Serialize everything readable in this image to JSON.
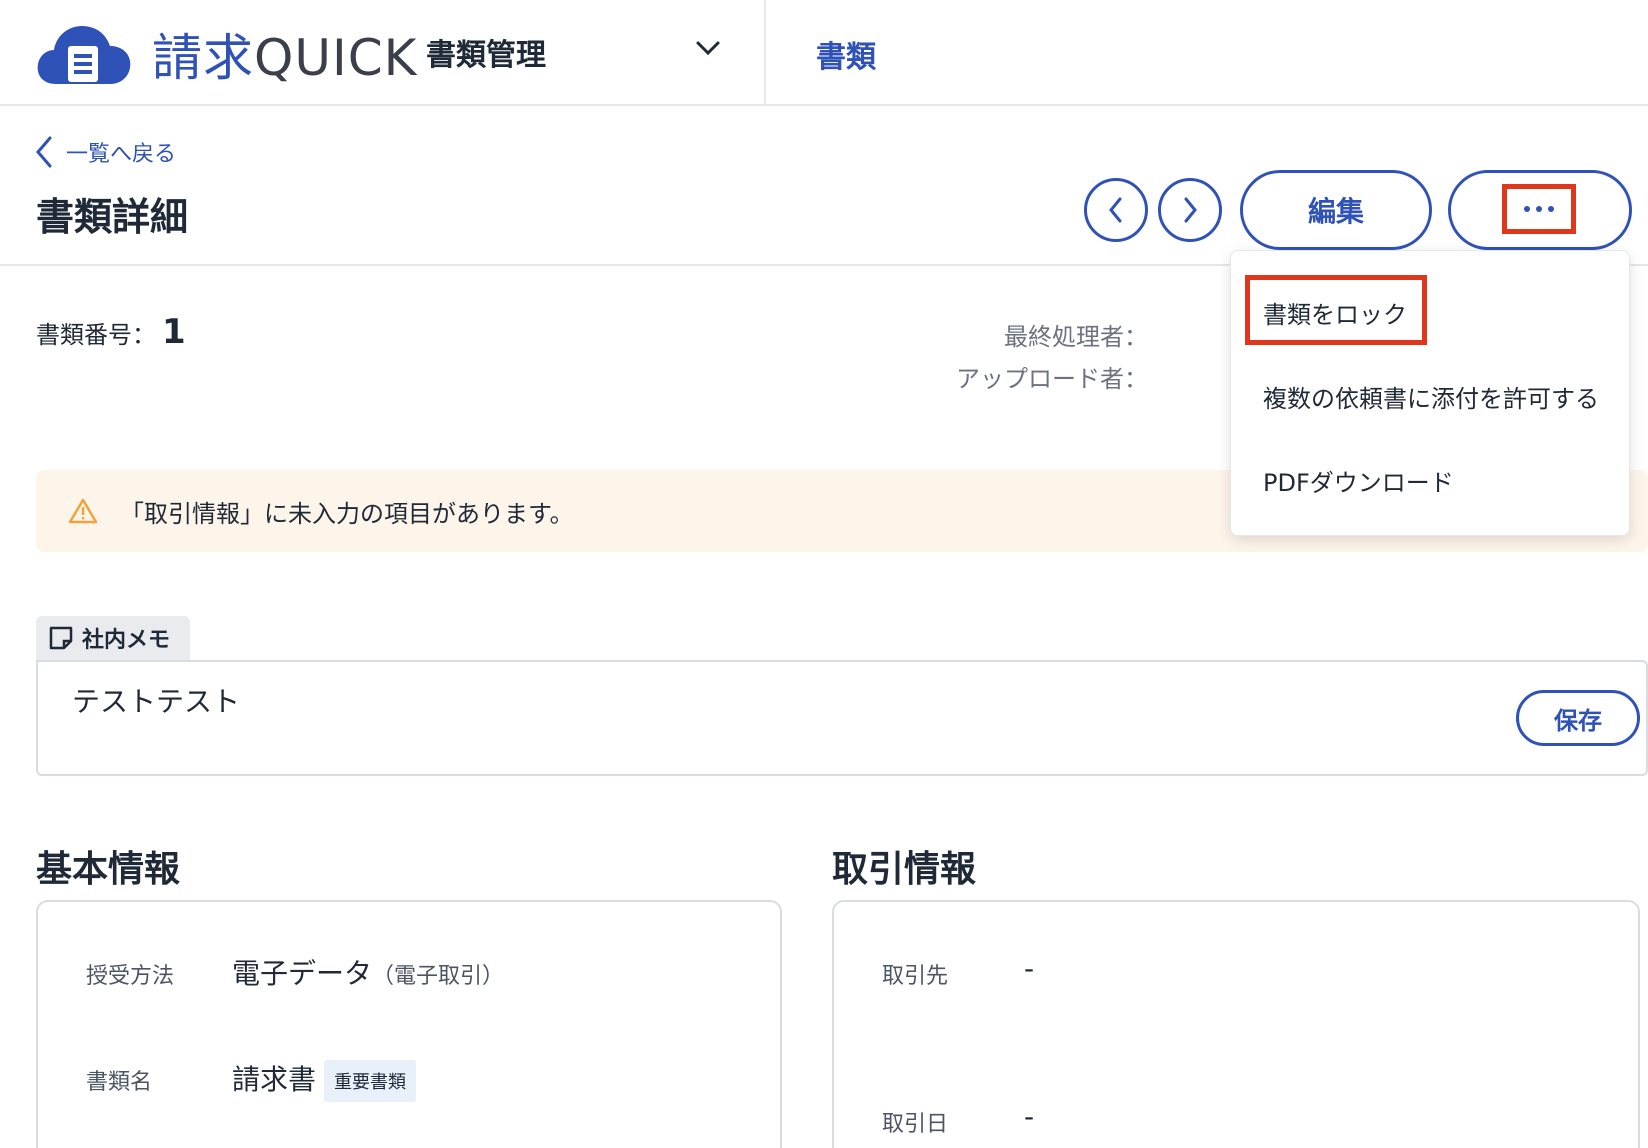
{
  "header": {
    "logo_text_jp": "請求",
    "logo_text_en": "QUICK",
    "app_select": "書類管理",
    "nav_tab": "書類"
  },
  "subheader": {
    "back_label": "一覧へ戻る",
    "page_title": "書類詳細",
    "edit_label": "編集"
  },
  "meta": {
    "doc_no_label": "書類番号：",
    "doc_no": "1",
    "last_processor_label": "最終処理者：",
    "uploader_label": "アップロード者："
  },
  "warning": {
    "text": "「取引情報」に未入力の項目があります。"
  },
  "memo": {
    "tab_label": "社内メモ",
    "text": "テストテスト",
    "save_label": "保存"
  },
  "basic_info": {
    "title": "基本情報",
    "fields": [
      {
        "label": "授受方法",
        "value": "電子データ",
        "sub": "（電子取引）"
      },
      {
        "label": "書類名",
        "value": "請求書",
        "badge": "重要書類"
      }
    ]
  },
  "transaction_info": {
    "title": "取引情報",
    "fields": [
      {
        "label": "取引先",
        "value": "-"
      },
      {
        "label": "取引日",
        "value": "-"
      }
    ]
  },
  "dropdown": {
    "items": [
      {
        "label": "書類をロック"
      },
      {
        "label": "複数の依頼書に添付を許可する"
      },
      {
        "label": "PDFダウンロード"
      }
    ]
  },
  "colors": {
    "accent": "#2f52b8",
    "highlight": "#e0361b",
    "warning_bg": "#fdf4ea",
    "warning_icon": "#f0a33a"
  },
  "icons": {
    "logo": "cloud-document-icon",
    "chevron_down": "chevron-down-icon",
    "back": "chevron-left-icon",
    "prev": "chevron-left-icon",
    "next": "chevron-right-icon",
    "more": "ellipsis-icon",
    "warning": "warning-triangle-icon",
    "memo": "note-icon"
  }
}
